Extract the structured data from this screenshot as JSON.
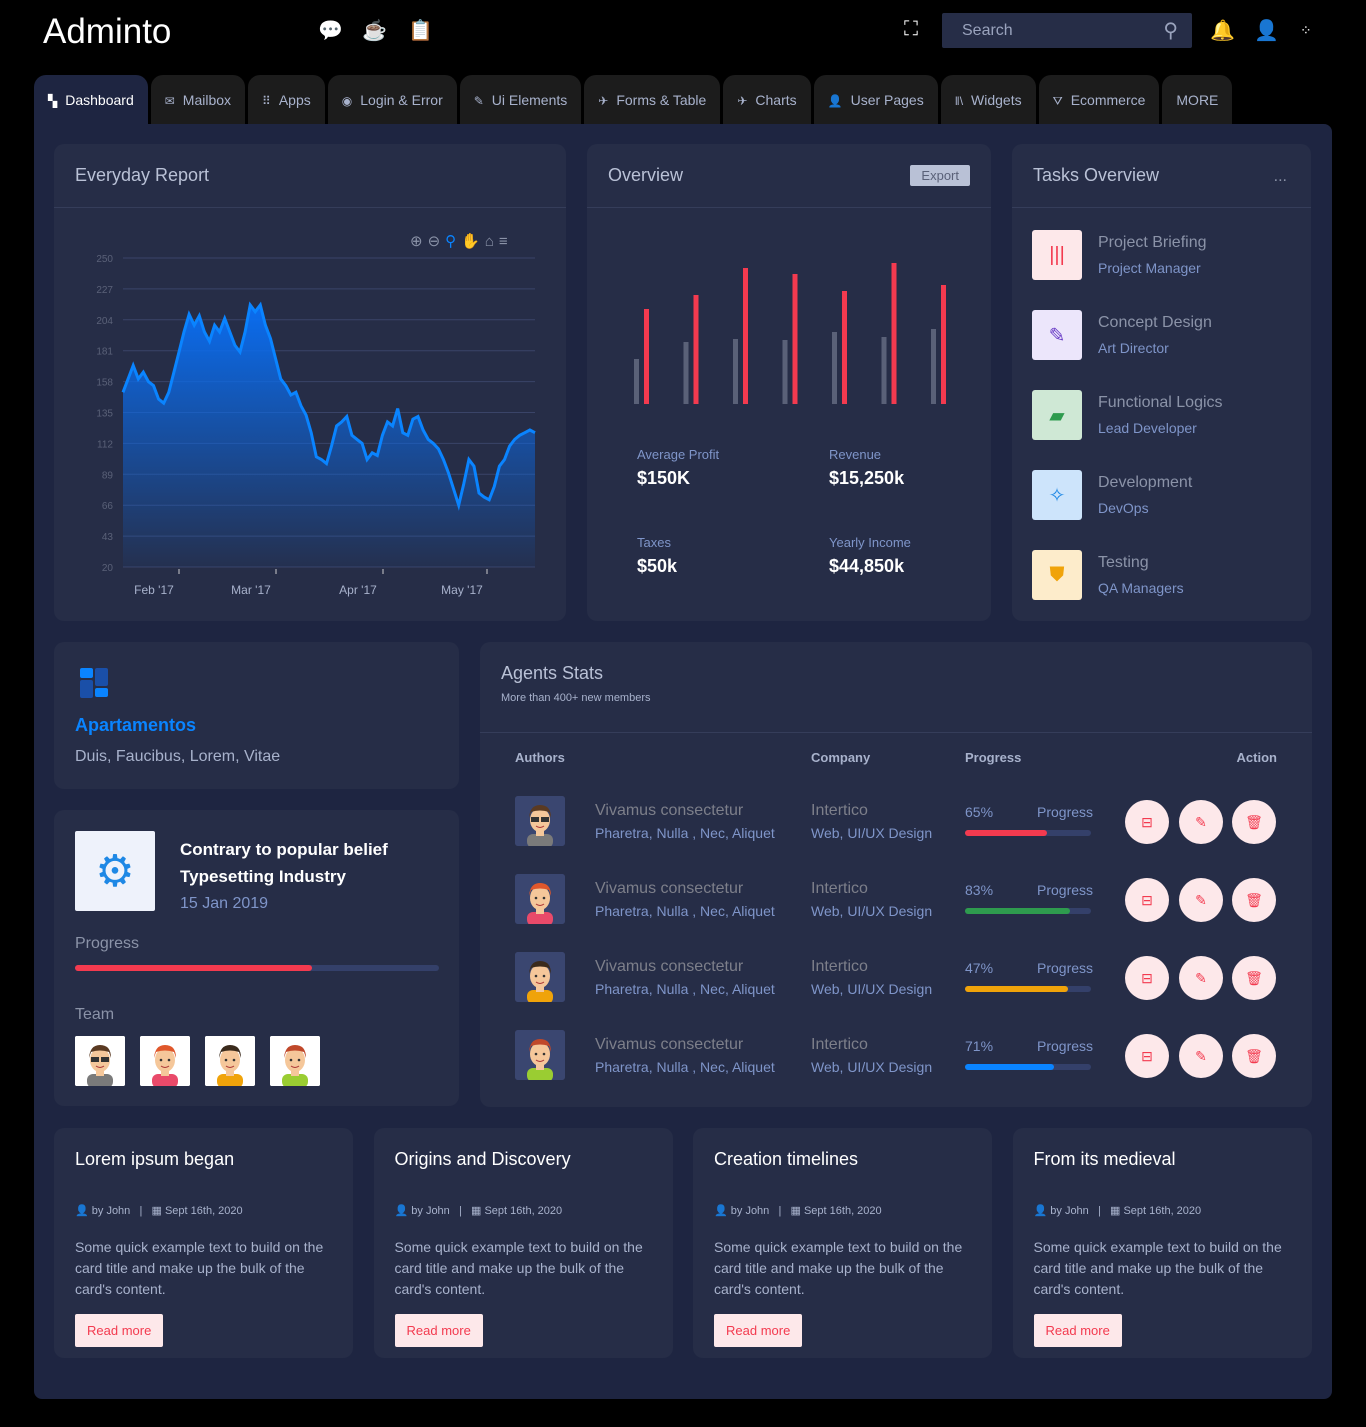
{
  "app": {
    "title": "Adminto"
  },
  "topbar": {
    "search_placeholder": "Search",
    "icons": [
      "chat-icon",
      "coffee-icon",
      "clipboard-icon",
      "fullscreen-icon",
      "bell-icon",
      "user-icon",
      "apps-icon"
    ]
  },
  "nav": {
    "tabs": [
      {
        "label": "Dashboard",
        "icon": "dashboard-icon",
        "active": true
      },
      {
        "label": "Mailbox",
        "icon": "mail-icon"
      },
      {
        "label": "Apps",
        "icon": "grid-icon"
      },
      {
        "label": "Login & Error",
        "icon": "circle-icon"
      },
      {
        "label": "Ui Elements",
        "icon": "edit-icon"
      },
      {
        "label": "Forms & Table",
        "icon": "pin-icon"
      },
      {
        "label": "Charts",
        "icon": "pin-icon"
      },
      {
        "label": "User Pages",
        "icon": "user-icon"
      },
      {
        "label": "Widgets",
        "icon": "books-icon"
      },
      {
        "label": "Ecommerce",
        "icon": "basket-icon"
      },
      {
        "label": "MORE"
      }
    ]
  },
  "report": {
    "title": "Everyday Report"
  },
  "chart_data": {
    "type": "area",
    "ylim": [
      20,
      250
    ],
    "yticks": [
      250,
      227,
      204,
      181,
      158,
      135,
      112,
      89,
      66,
      43,
      20
    ],
    "xtick_labels": [
      "Feb '17",
      "Mar '17",
      "Apr '17",
      "May '17"
    ],
    "grid": true,
    "color": "#0a84ff",
    "values": [
      150,
      160,
      170,
      160,
      165,
      158,
      155,
      145,
      142,
      150,
      165,
      180,
      195,
      208,
      200,
      207,
      195,
      188,
      200,
      195,
      205,
      195,
      185,
      180,
      195,
      215,
      210,
      215,
      200,
      190,
      175,
      160,
      155,
      148,
      150,
      140,
      133,
      120,
      102,
      100,
      97,
      110,
      125,
      128,
      132,
      118,
      115,
      112,
      100,
      105,
      103,
      118,
      128,
      125,
      138,
      120,
      118,
      130,
      132,
      122,
      115,
      112,
      108,
      100,
      90,
      78,
      66,
      82,
      100,
      95,
      75,
      72,
      70,
      80,
      95,
      100,
      110,
      115,
      118,
      120,
      122,
      120
    ]
  },
  "overview": {
    "title": "Overview",
    "export_label": "Export",
    "bars": {
      "series": [
        {
          "color": "#5a6178",
          "values": [
            45,
            62,
            65,
            64,
            72,
            67,
            75
          ]
        },
        {
          "color": "#f33a4f",
          "values": [
            95,
            109,
            136,
            130,
            113,
            141,
            119
          ]
        }
      ]
    },
    "stats": [
      {
        "label": "Average Profit",
        "value": "$150K"
      },
      {
        "label": "Revenue",
        "value": "$15,250k"
      },
      {
        "label": "Taxes",
        "value": "$50k"
      },
      {
        "label": "Yearly Income",
        "value": "$44,850k"
      }
    ]
  },
  "tasks": {
    "title": "Tasks Overview",
    "menu": "...",
    "items": [
      {
        "title": "Project Briefing",
        "role": "Project Manager",
        "icon": "books-icon",
        "bg": "#fde8ea",
        "fg": "#f33a4f",
        "glyph": "|||"
      },
      {
        "title": "Concept Design",
        "role": "Art Director",
        "icon": "edit-icon",
        "bg": "#ece6fb",
        "fg": "#6b3fc7",
        "glyph": "✎"
      },
      {
        "title": "Functional Logics",
        "role": "Lead Developer",
        "icon": "chat-icon",
        "bg": "#cfe8d5",
        "fg": "#2e9b4e",
        "glyph": "▰"
      },
      {
        "title": "Development",
        "role": "DevOps",
        "icon": "gear-icon",
        "bg": "#cde4fb",
        "fg": "#1e88e5",
        "glyph": "✧"
      },
      {
        "title": "Testing",
        "role": "QA Managers",
        "icon": "shield-icon",
        "bg": "#fdeccb",
        "fg": "#f0a30a",
        "glyph": "⛊"
      }
    ]
  },
  "apartment": {
    "title": "Apartamentos",
    "subtitle": "Duis, Faucibus, Lorem, Vitae"
  },
  "project": {
    "title1": "Contrary to popular belief",
    "title2": "Typesetting Industry",
    "date": "15 Jan 2019",
    "progress_label": "Progress",
    "progress": 65,
    "team_label": "Team"
  },
  "agents": {
    "title": "Agents Stats",
    "subtitle": "More than 400+ new members",
    "headers": [
      "Authors",
      "Company",
      "Progress",
      "Action"
    ],
    "rows": [
      {
        "name": "Vivamus consectetur",
        "tags": "Pharetra, Nulla , Nec, Aliquet",
        "company": "Intertico",
        "role": "Web, UI/UX Design",
        "pct": "65%",
        "pct_value": 65,
        "plabel": "Progress",
        "color": "#f33a4f"
      },
      {
        "name": "Vivamus consectetur",
        "tags": "Pharetra, Nulla , Nec, Aliquet",
        "company": "Intertico",
        "role": "Web, UI/UX Design",
        "pct": "83%",
        "pct_value": 83,
        "plabel": "Progress",
        "color": "#2e9b4e"
      },
      {
        "name": "Vivamus consectetur",
        "tags": "Pharetra, Nulla , Nec, Aliquet",
        "company": "Intertico",
        "role": "Web, UI/UX Design",
        "pct": "47%",
        "pct_value": 82,
        "plabel": "Progress",
        "color": "#f0a30a"
      },
      {
        "name": "Vivamus consectetur",
        "tags": "Pharetra, Nulla , Nec, Aliquet",
        "company": "Intertico",
        "role": "Web, UI/UX Design",
        "pct": "71%",
        "pct_value": 71,
        "plabel": "Progress",
        "color": "#0a84ff"
      }
    ]
  },
  "posts": [
    {
      "title": "Lorem ipsum began",
      "author": "by John",
      "date": "Sept 16th, 2020",
      "text": "Some quick example text to build on the card title and make up the bulk of the card's content.",
      "button": "Read more"
    },
    {
      "title": "Origins and Discovery",
      "author": "by John",
      "date": "Sept 16th, 2020",
      "text": "Some quick example text to build on the card title and make up the bulk of the card's content.",
      "button": "Read more"
    },
    {
      "title": "Creation timelines",
      "author": "by John",
      "date": "Sept 16th, 2020",
      "text": "Some quick example text to build on the card title and make up the bulk of the card's content.",
      "button": "Read more"
    },
    {
      "title": "From its medieval",
      "author": "by John",
      "date": "Sept 16th, 2020",
      "text": "Some quick example text to build on the card title and make up the bulk of the card's content.",
      "button": "Read more"
    }
  ]
}
